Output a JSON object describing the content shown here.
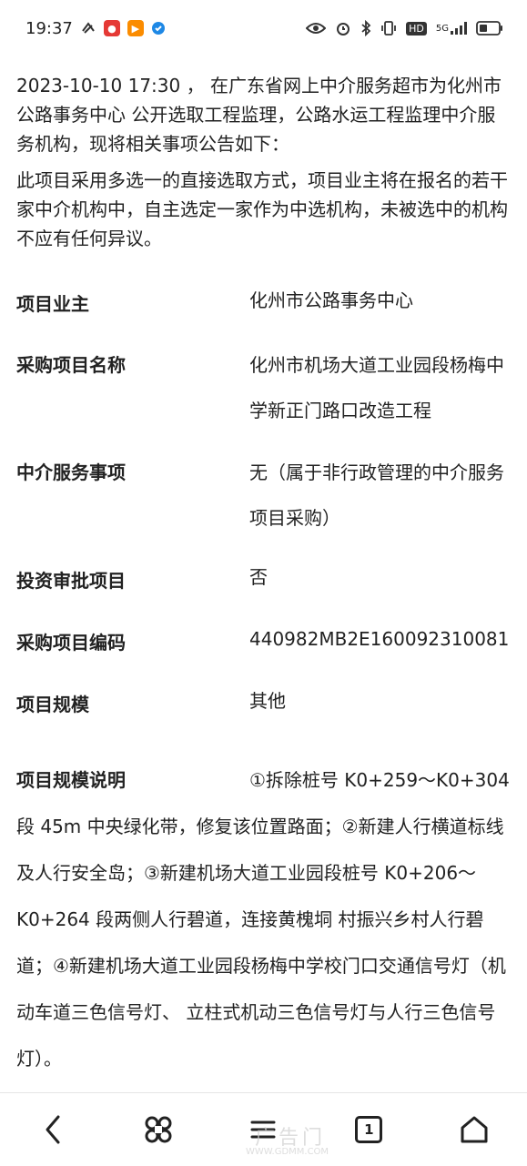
{
  "status_bar": {
    "time": "19:37",
    "icons": [
      "app-notification-icon",
      "app-red-icon",
      "app-orange-icon",
      "app-blue-icon",
      "eye-icon",
      "alarm-icon",
      "bluetooth-icon",
      "vibrate-icon",
      "hd-icon",
      "5g-signal-icon",
      "battery-icon"
    ],
    "hd_label": "HD",
    "network_label": "5G"
  },
  "intro": {
    "paragraph1": "2023-10-10 17:30 ， 在广东省网上中介服务超市为化州市公路事务中心 公开选取工程监理，公路水运工程监理中介服务机构，现将相关事项公告如下：",
    "paragraph2": "此项目采用多选一的直接选取方式，项目业主将在报名的若干家中介机构中，自主选定一家作为中选机构，未被选中的机构不应有任何异议。"
  },
  "details": [
    {
      "label": "项目业主",
      "value": "化州市公路事务中心"
    },
    {
      "label": "采购项目名称",
      "value": "化州市机场大道工业园段杨梅中学新正门路口改造工程"
    },
    {
      "label": "中介服务事项",
      "value": "无（属于非行政管理的中介服务项目采购）"
    },
    {
      "label": "投资审批项目",
      "value": "否"
    },
    {
      "label": "采购项目编码",
      "value": "440982MB2E160092310081"
    },
    {
      "label": "项目规模",
      "value": "其他"
    }
  ],
  "scale_description": {
    "label": "项目规模说明",
    "value": "①拆除桩号 K0+259～K0+304 段 45m 中央绿化带，修复该位置路面；②新建人行横道标线及人行安全岛；③新建机场大道工业园段桩号 K0+206～K0+264 段两侧人行碧道，连接黄槐垌 村振兴乡村人行碧道；④新建机场大道工业园段杨梅中学校门口交通信号灯（机动车道三色信号灯、 立柱式机动三色信号灯与人行三色信号灯）。"
  },
  "nav_bar": {
    "tab_count": "1",
    "icons": [
      "back-icon",
      "shortcuts-icon",
      "menu-icon",
      "tabs-icon",
      "home-icon"
    ]
  },
  "watermark": {
    "text": "广告门",
    "url": "WWW.GDMM.COM"
  }
}
